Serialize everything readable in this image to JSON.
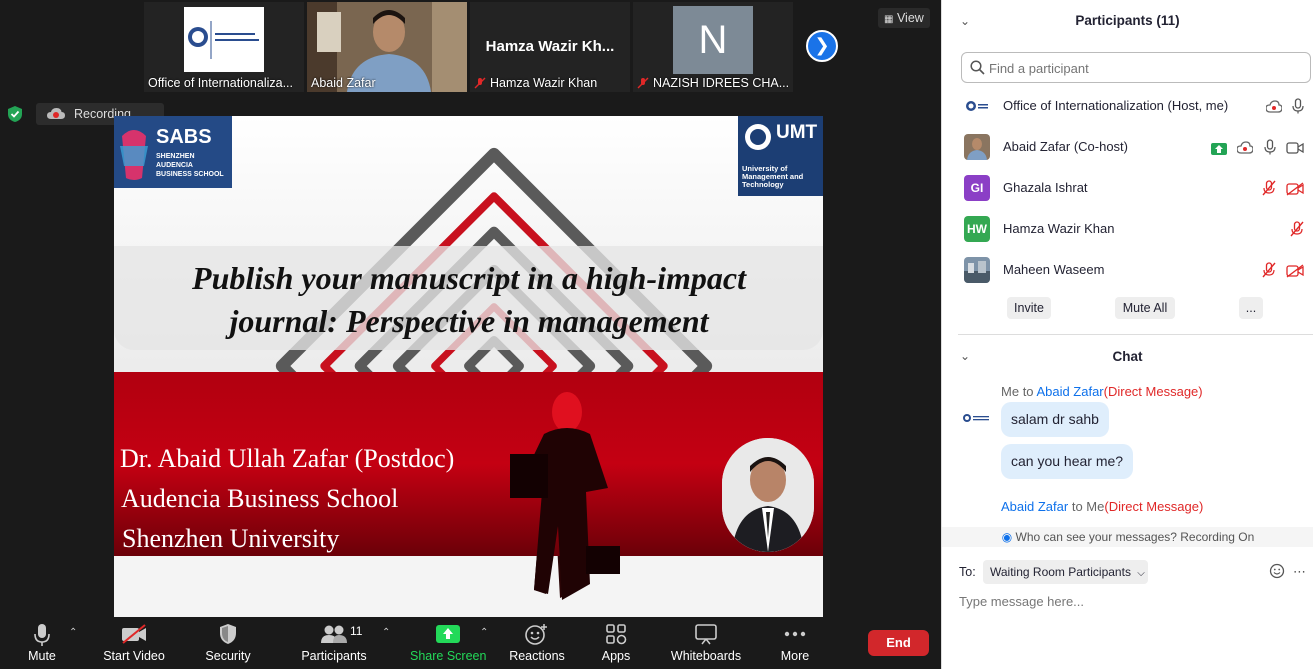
{
  "gallery": {
    "tiles": [
      {
        "name": "Office of Internationaliza...",
        "muted": false
      },
      {
        "name": "Abaid Zafar",
        "muted": false
      },
      {
        "name": "Hamza Wazir Khan",
        "display": "Hamza  Wazir  Kh...",
        "muted": true
      },
      {
        "name": "NAZISH IDREES CHA...",
        "initial": "N",
        "muted": true
      }
    ],
    "view_label": "View",
    "next_icon": "chevron-right-icon"
  },
  "recording": {
    "label": "Recording..."
  },
  "slide": {
    "logo_left": {
      "name": "SABS",
      "subtitle": "SHENZHEN AUDENCIA BUSINESS SCHOOL"
    },
    "logo_right": {
      "name": "UMT",
      "subtitle": "University of Management and Technology"
    },
    "title_line1": "Publish your manuscript in a high-impact",
    "title_line2": "journal: Perspective in management",
    "author_line1": "Dr. Abaid Ullah Zafar (Postdoc)",
    "author_line2": "Audencia Business School",
    "author_line3": "Shenzhen University"
  },
  "toolbar": {
    "mute": "Mute",
    "start_video": "Start Video",
    "security": "Security",
    "participants": "Participants",
    "participants_count": "11",
    "share_screen": "Share Screen",
    "reactions": "Reactions",
    "apps": "Apps",
    "whiteboards": "Whiteboards",
    "more": "More",
    "end": "End",
    "share_color": "#23d959",
    "end_color": "#d2272b"
  },
  "participants_panel": {
    "title": "Participants (11)",
    "search_placeholder": "Find a participant",
    "list": [
      {
        "name": "Office of Internationalization (Host, me)",
        "avatar": "logo"
      },
      {
        "name": "Abaid Zafar (Co-host)",
        "avatar": "photo"
      },
      {
        "name": "Ghazala Ishrat",
        "avatar": "GI",
        "avatar_color": "#8b3fc6"
      },
      {
        "name": "Hamza Wazir Khan",
        "avatar": "HW",
        "avatar_color": "#34a852"
      },
      {
        "name": "Maheen Waseem",
        "avatar": "photo"
      }
    ],
    "buttons": {
      "invite": "Invite",
      "mute_all": "Mute All",
      "more": "..."
    }
  },
  "chat": {
    "title": "Chat",
    "messages": [
      {
        "from": "Me",
        "to_word": "to",
        "to": "Abaid Zafar",
        "tag": "(Direct Message)",
        "bubbles": [
          "salam dr sahb",
          "can you hear me?"
        ]
      },
      {
        "from": "Abaid Zafar",
        "to_word": "to",
        "to": "Me",
        "tag": "(Direct Message)"
      }
    ],
    "privacy": "Who can see your messages? Recording On",
    "to_label": "To:",
    "to_value": "Waiting Room Participants",
    "input_placeholder": "Type message here..."
  }
}
